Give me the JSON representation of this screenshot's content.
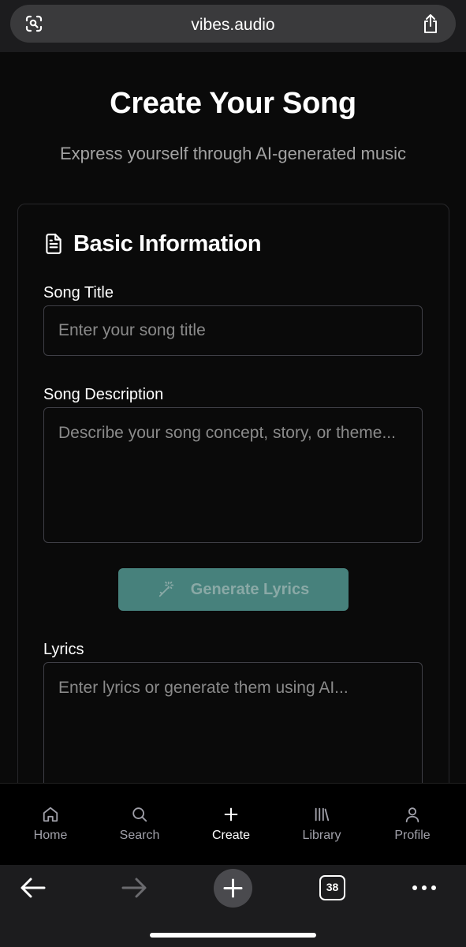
{
  "browser": {
    "url": "vibes.audio",
    "left_icon": "reader-scan-icon",
    "right_icon": "share-icon",
    "toolbar": {
      "back_icon": "arrow-left-icon",
      "forward_icon": "arrow-right-icon",
      "new_tab_icon": "plus-icon",
      "tab_count": "38",
      "more_icon": "more-dots-icon"
    }
  },
  "page": {
    "title": "Create Your Song",
    "subtitle": "Express yourself through AI-generated music"
  },
  "card": {
    "icon": "document-icon",
    "title": "Basic Information",
    "song_title": {
      "label": "Song Title",
      "placeholder": "Enter your song title"
    },
    "song_description": {
      "label": "Song Description",
      "placeholder": "Describe your song concept, story, or theme..."
    },
    "generate_button": {
      "icon": "magic-wand-icon",
      "label": "Generate Lyrics"
    },
    "lyrics": {
      "label": "Lyrics",
      "placeholder": "Enter lyrics or generate them using AI..."
    }
  },
  "nav": {
    "items": [
      {
        "label": "Home",
        "icon": "home-icon",
        "active": false
      },
      {
        "label": "Search",
        "icon": "search-icon",
        "active": false
      },
      {
        "label": "Create",
        "icon": "plus-icon",
        "active": true
      },
      {
        "label": "Library",
        "icon": "library-icon",
        "active": false
      },
      {
        "label": "Profile",
        "icon": "user-icon",
        "active": false
      }
    ]
  },
  "colors": {
    "background": "#0a0a0a",
    "accent_button": "#47817c",
    "muted_text": "#a3a3a3"
  }
}
